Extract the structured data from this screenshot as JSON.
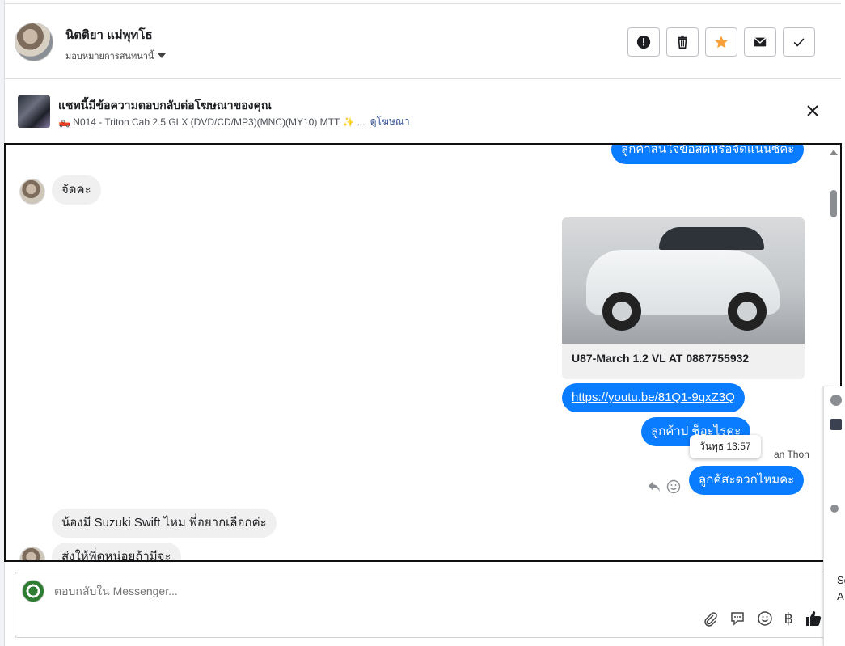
{
  "header": {
    "contact_name": "นิตติยา แม่พุทโธ",
    "assign_label": "มอบหมายการสนทนานี้"
  },
  "ad_banner": {
    "title": "แชทนี้มีข้อความตอบกลับต่อโฆษณาของคุณ",
    "product": "🛻 N014 - Triton Cab 2.5 GLX (DVD/CD/MP3)(MNC)(MY10) MTT ✨ ...",
    "view_ad_link": "ดูโฆษณา"
  },
  "messages": {
    "top_partial": "ลูกค้าสนใจข้อสดหรือจัดแนนซ์คะ",
    "in_1": "จัดคะ",
    "card_caption": "U87-March 1.2 VL AT 0887755932",
    "link": "https://youtu.be/81Q1-9qxZ3Q",
    "out_2": "ลูกค้าป              ช็อะไรคะ",
    "tooltip_time": "วันพุธ 13:57",
    "seen_by": "an Thon",
    "out_3": "ลูกค้สะดวกไหมคะ",
    "in_2": "น้องมี Suzuki Swift ไหม พี่อยากเลือกค่ะ",
    "in_3": "ส่งให้พี่ดหน่อยถ้ามีจะ"
  },
  "composer": {
    "placeholder": "ตอบกลับใน Messenger..."
  },
  "right_panel": {
    "letters": [
      "Sc",
      "A"
    ]
  },
  "colors": {
    "outgoing_bubble": "#0a7cff",
    "incoming_bubble": "#f0f0f0",
    "star_accent": "#f7a13b"
  }
}
